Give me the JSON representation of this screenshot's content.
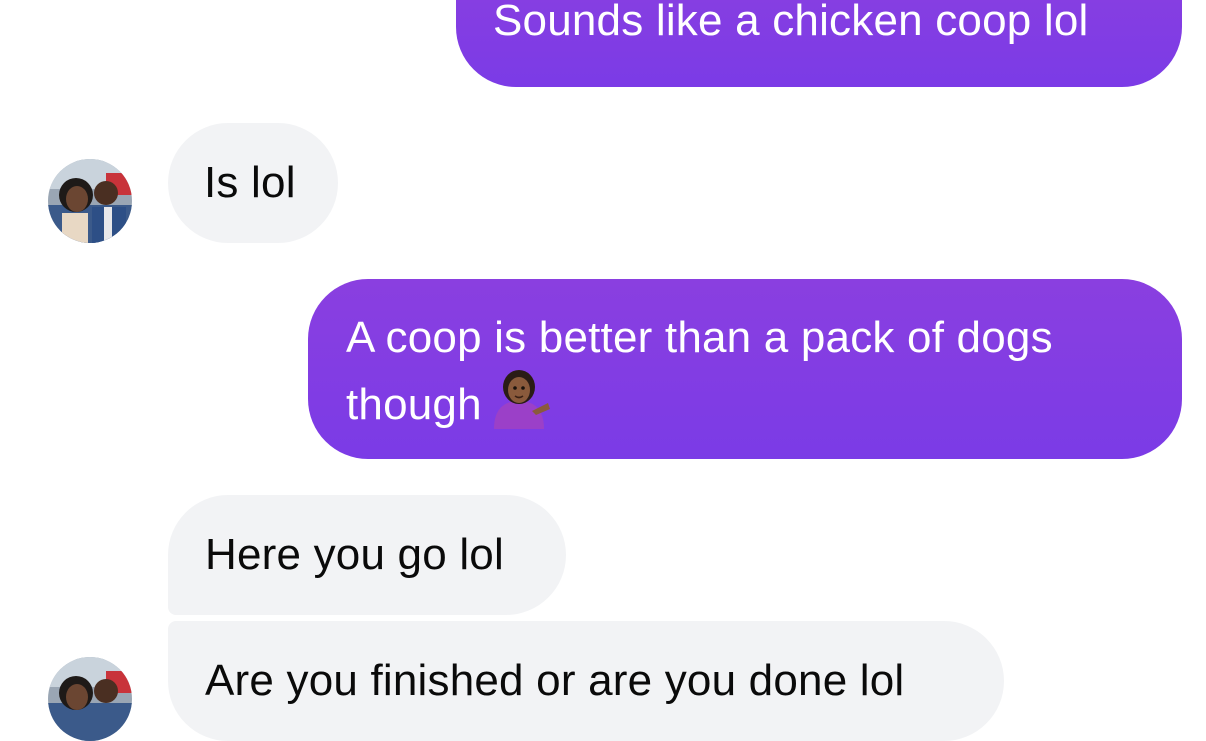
{
  "conversation": {
    "messages": [
      {
        "direction": "outgoing",
        "text": "Sounds like a chicken coop lol"
      },
      {
        "direction": "incoming",
        "text": "Is lol"
      },
      {
        "direction": "outgoing",
        "line1": "A coop is better than a pack of dogs",
        "line2": "though",
        "emoji": "woman-tipping-hand-icon"
      },
      {
        "direction": "incoming",
        "text": "Here you go lol"
      },
      {
        "direction": "incoming",
        "text": "Are you finished or are you done lol"
      }
    ]
  },
  "colors": {
    "outgoing_bubble": "#8a3fe0",
    "incoming_bubble": "#f2f3f5",
    "outgoing_text": "#ffffff",
    "incoming_text": "#0a0a0a"
  }
}
